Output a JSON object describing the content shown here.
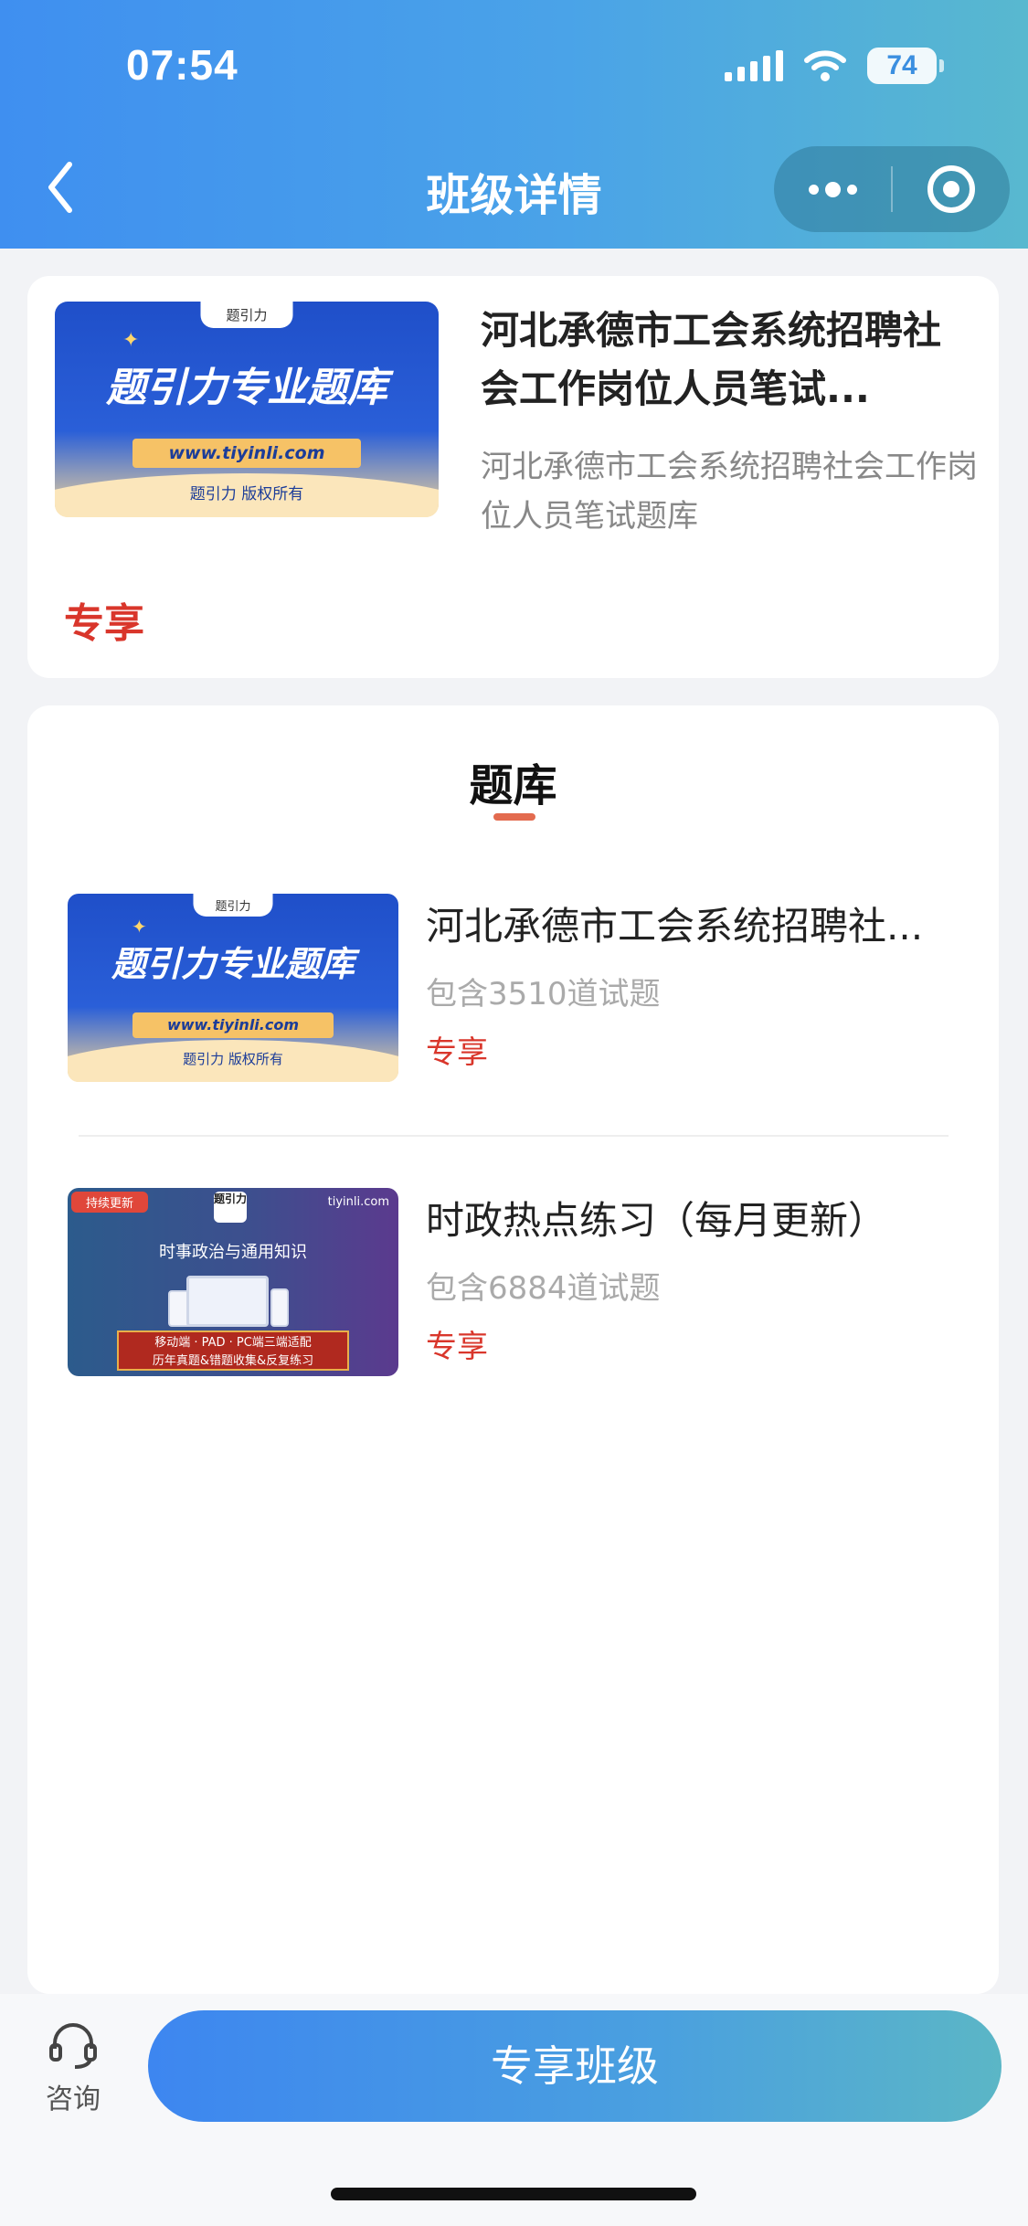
{
  "status_bar": {
    "time": "07:54",
    "battery": "74"
  },
  "nav": {
    "title": "班级详情"
  },
  "course": {
    "title": "河北承德市工会系统招聘社会工作岗位人员笔试...",
    "description": "河北承德市工会系统招聘社会工作岗位人员笔试题库",
    "badge": "专享",
    "banner": {
      "tag": "题引力",
      "headline": "题引力专业题库",
      "url": "www.tiyinli.com",
      "copyright": "题引力 版权所有"
    }
  },
  "section": {
    "title": "题库"
  },
  "banks": [
    {
      "title": "河北承德市工会系统招聘社...",
      "count": "包含3510道试题",
      "badge": "专享",
      "thumb": {
        "tag": "题引力",
        "headline": "题引力专业题库",
        "url": "www.tiyinli.com",
        "copyright": "题引力 版权所有"
      }
    },
    {
      "title": "时政热点练习（每月更新）",
      "count": "包含6884道试题",
      "badge": "专享",
      "thumb": {
        "pill": "持续更新",
        "logo": "题引力",
        "site": "tiyinli.com",
        "heading": "时事政治与通用知识",
        "line1": "移动端 · PAD · PC端三端适配",
        "line2": "历年真题&错题收集&反复练习"
      }
    }
  ],
  "bottom": {
    "consult_label": "咨询",
    "cta_label": "专享班级"
  },
  "colors": {
    "accent_red": "#d9362b",
    "brand_blue": "#3f8ff0",
    "brand_teal": "#58b8cf"
  }
}
